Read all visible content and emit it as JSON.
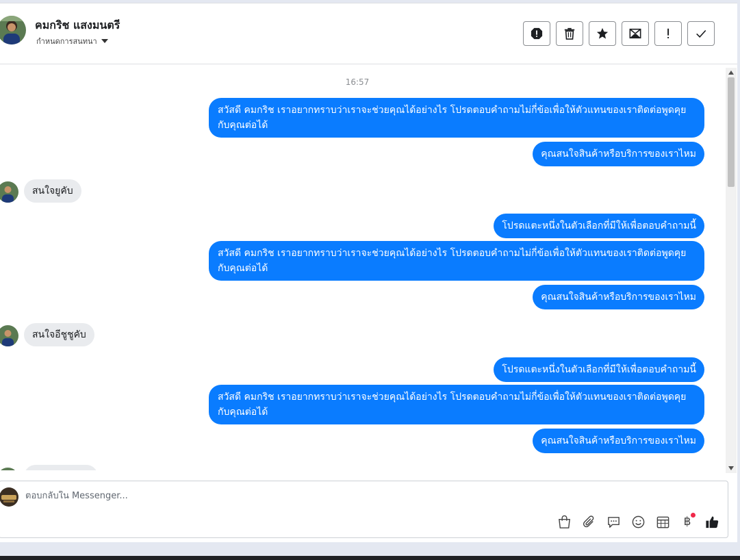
{
  "header": {
    "contact_name": "คมกริช แสงมนตรี",
    "conversation_setting": "กำหนดการสนทนา",
    "actions": [
      {
        "name": "mark-spam-icon"
      },
      {
        "name": "trash-icon"
      },
      {
        "name": "star-icon"
      },
      {
        "name": "archive-mail-icon"
      },
      {
        "name": "important-icon"
      },
      {
        "name": "check-icon"
      }
    ]
  },
  "messages": {
    "timestamp": "16:57",
    "greeting": "สวัสดี คมกริช เราอยากทราบว่าเราจะช่วยคุณได้อย่างไร โปรดตอบคำถามไม่กี่ข้อเพื่อให้ตัวแทนของเราติดต่อพูดคุยกับคุณต่อได้",
    "question": "คุณสนใจสินค้าหรือบริการของเราไหม",
    "prompt": "โปรดแตะหนึ่งในตัวเลือกที่มีให้เพื่อตอบคำถามนี้",
    "reply_1": "สนใจยูคับ",
    "reply_2": "สนใจอีชูชูคับ"
  },
  "composer": {
    "placeholder": "ตอบกลับใน Messenger...",
    "tools": [
      "shopping-bag-icon",
      "paperclip-icon",
      "saved-replies-icon",
      "emoji-icon",
      "appointment-icon",
      "payment-baht-icon",
      "like-icon"
    ],
    "baht_symbol": "฿"
  },
  "colors": {
    "outgoing_bubble": "#0a7cff",
    "incoming_bubble": "#e9ebee",
    "badge": "#f0284a"
  }
}
